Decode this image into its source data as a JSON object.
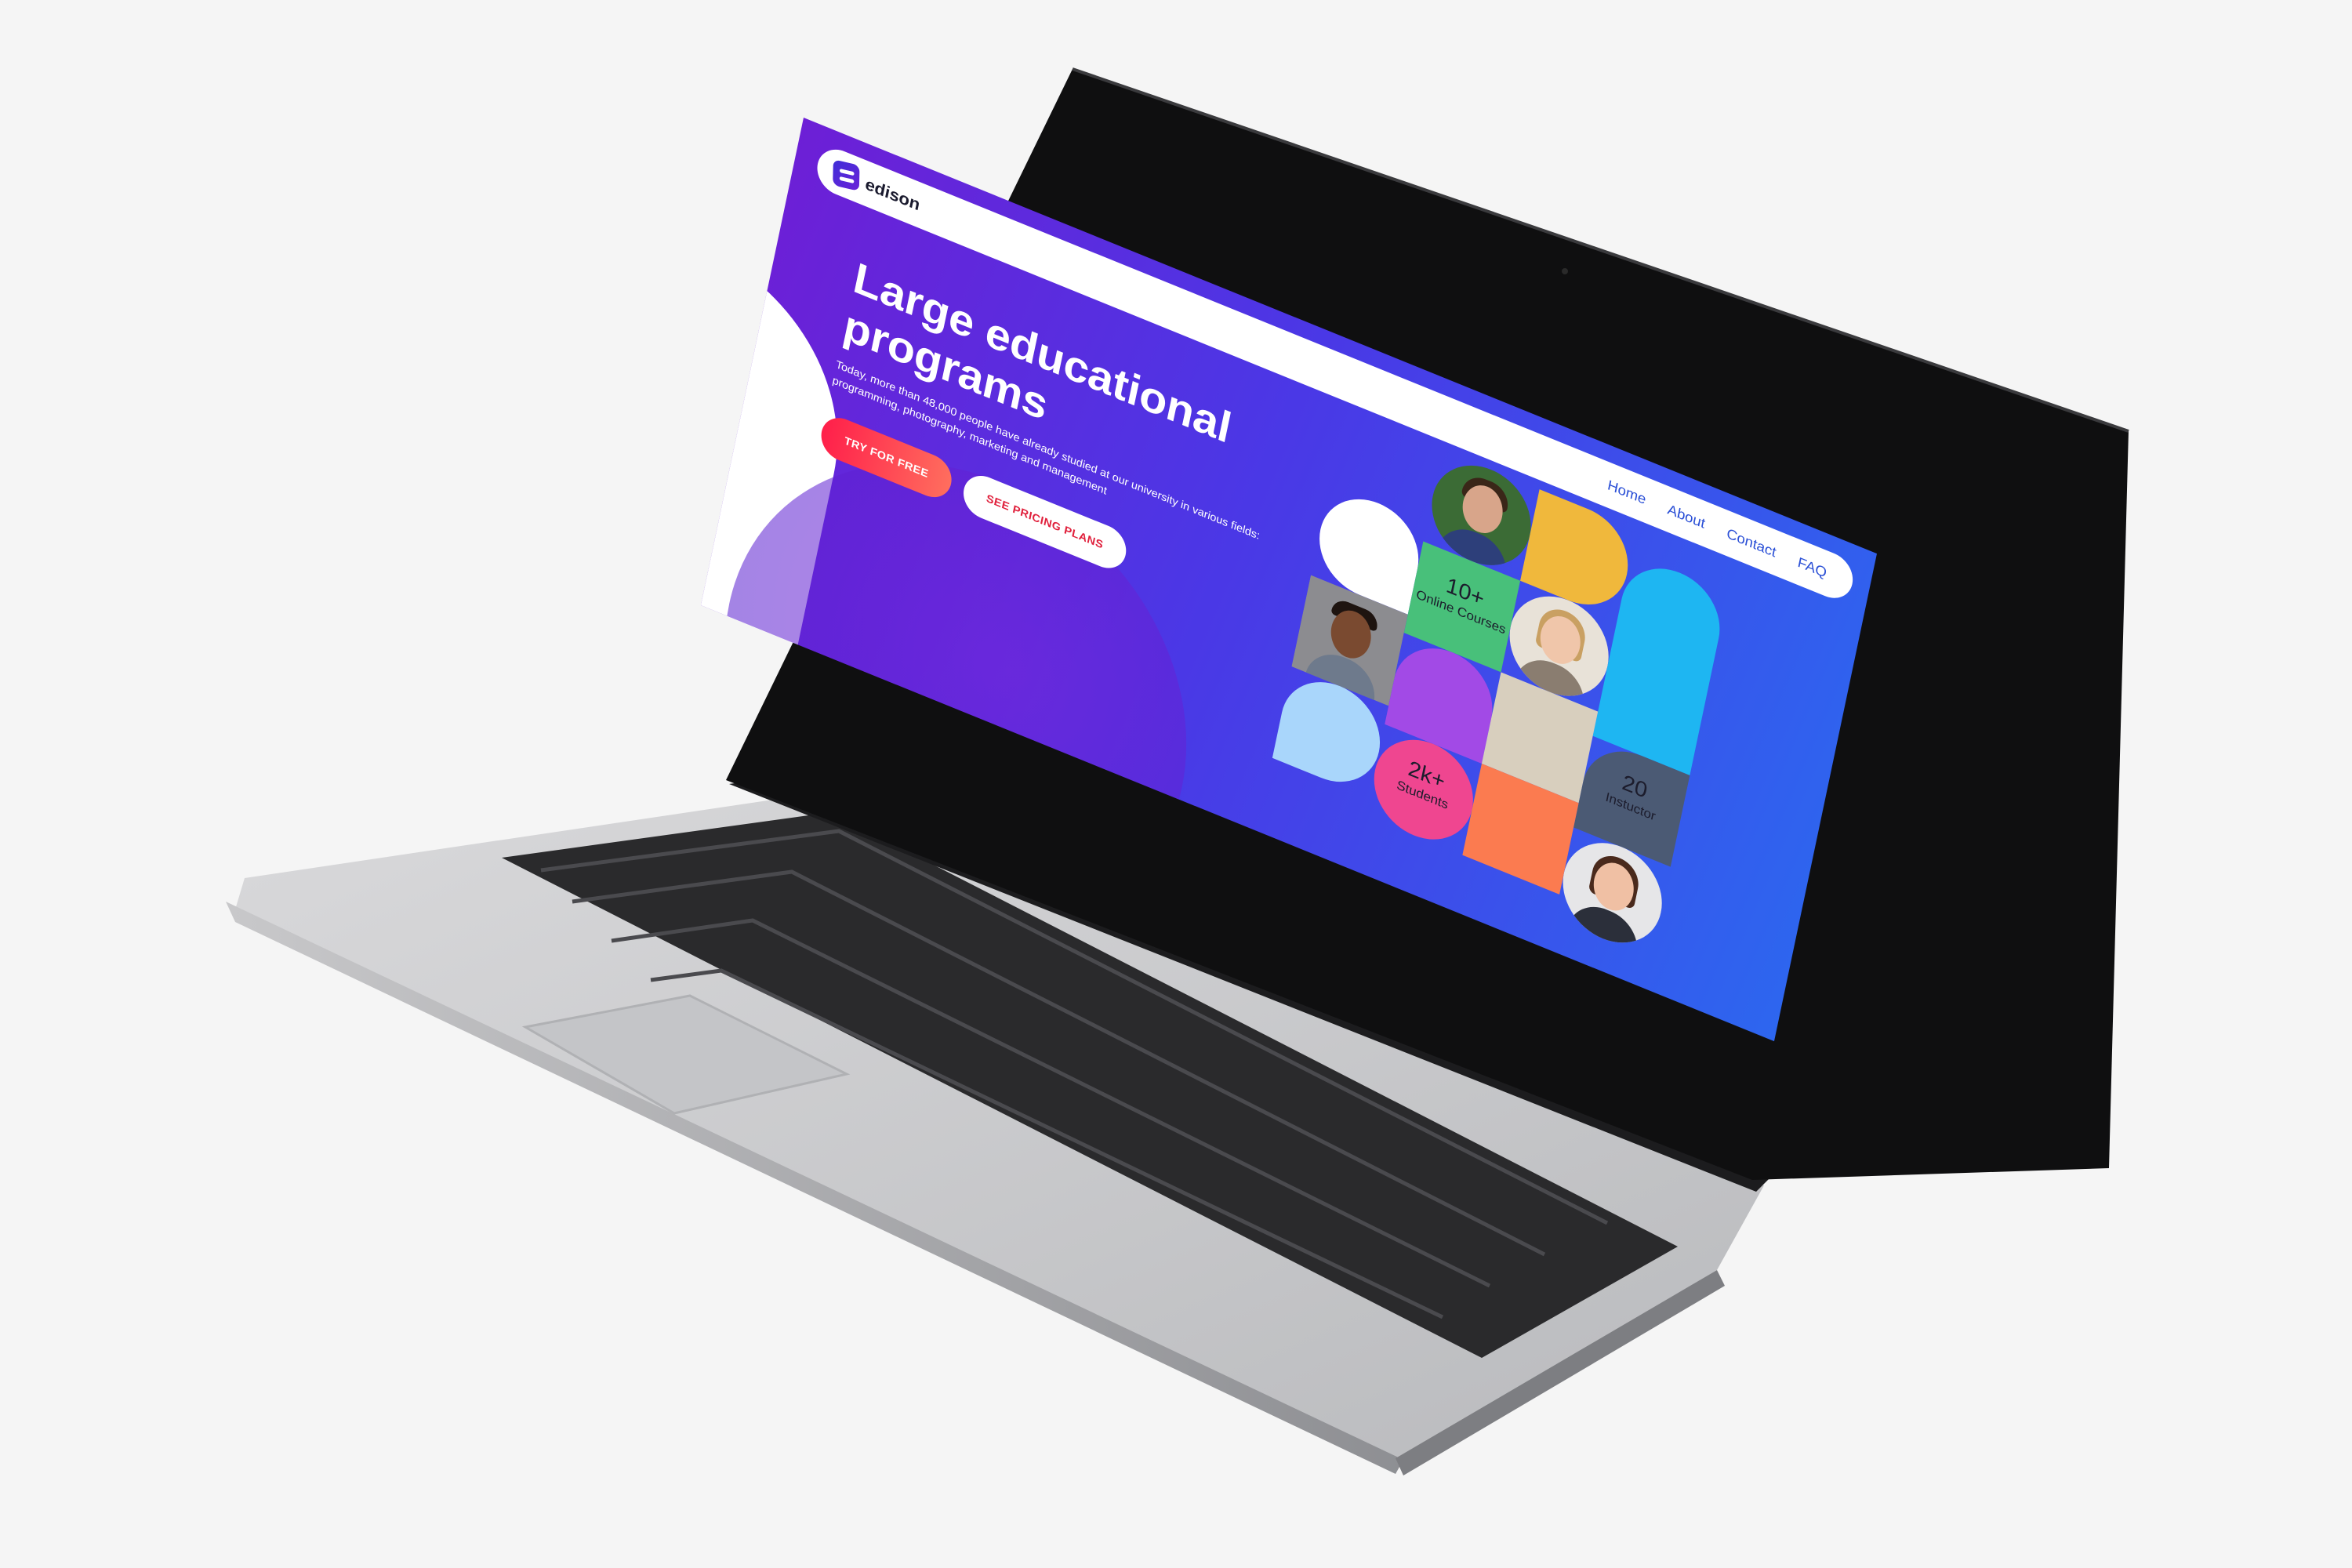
{
  "site": {
    "logo_text": "edison",
    "nav": [
      "Home",
      "About",
      "Contact",
      "FAQ"
    ]
  },
  "hero": {
    "title": "Large educational programs",
    "description": "Today, more than 48,000 people have already studied at our university in various fields: programming, photography, marketing and management",
    "cta_primary": "TRY FOR FREE",
    "cta_secondary": "SEE PRICING PLANS"
  },
  "stats": {
    "courses": {
      "value": "10+",
      "label": "Online Courses"
    },
    "instructors": {
      "value": "20",
      "label": "Instuctor"
    },
    "students": {
      "value": "2k+",
      "label": "Students"
    }
  },
  "colors": {
    "gradient_start": "#6d1fd6",
    "gradient_end": "#2d66ef",
    "accent_red": "#ff1f4a",
    "nav_link": "#2a4fd6",
    "tile_yellow": "#f0b83c",
    "tile_green": "#48c07a",
    "tile_sky": "#1eb6f2",
    "tile_purple": "#a24ae6",
    "tile_beige": "#d8cfbe",
    "tile_slate": "#4b5a74",
    "tile_lightblue": "#a9d6fb",
    "tile_pink": "#ef4690",
    "tile_orange": "#fb7b50"
  }
}
